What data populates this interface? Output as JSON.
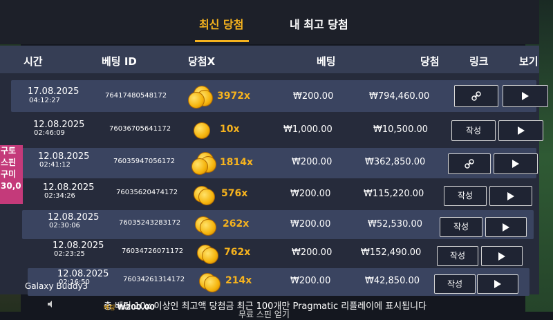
{
  "tabs": {
    "latest": "최신 당첨",
    "best": "내 최고 당첨"
  },
  "headers": {
    "time": "시간",
    "bet_id": "베팅 ID",
    "win_x": "당첨X",
    "bet": "베팅",
    "win": "당첨",
    "link": "링크",
    "view": "보기"
  },
  "rows": [
    {
      "date": "17.08.2025",
      "time": "04:12:27",
      "bet_id": "76417480548172",
      "coins": "stack",
      "multiplier": "3972x",
      "bet": "₩200.00",
      "win": "₩794,460.00",
      "link": "icon"
    },
    {
      "date": "12.08.2025",
      "time": "02:46:09",
      "bet_id": "76036705641172",
      "coins": "single",
      "multiplier": "10x",
      "bet": "₩1,000.00",
      "win": "₩10,500.00",
      "link": "작성"
    },
    {
      "date": "12.08.2025",
      "time": "02:41:12",
      "bet_id": "76035947056172",
      "coins": "stack",
      "multiplier": "1814x",
      "bet": "₩200.00",
      "win": "₩362,850.00",
      "link": "icon"
    },
    {
      "date": "12.08.2025",
      "time": "02:34:26",
      "bet_id": "76035620474172",
      "coins": "pair",
      "multiplier": "576x",
      "bet": "₩200.00",
      "win": "₩115,220.00",
      "link": "작성"
    },
    {
      "date": "12.08.2025",
      "time": "02:30:06",
      "bet_id": "76035243283172",
      "coins": "pair",
      "multiplier": "262x",
      "bet": "₩200.00",
      "win": "₩52,530.00",
      "link": "작성"
    },
    {
      "date": "12.08.2025",
      "time": "02:23:25",
      "bet_id": "76034726071172",
      "coins": "pair",
      "multiplier": "762x",
      "bet": "₩200.00",
      "win": "₩152,490.00",
      "link": "작성"
    },
    {
      "date": "12.08.2025",
      "time": "02:16:50",
      "bet_id": "76034261314172",
      "coins": "pair",
      "multiplier": "214x",
      "bet": "₩200.00",
      "win": "₩42,850.00",
      "link": "작성"
    }
  ],
  "footer": {
    "note": "총 베팅 10x 이상인 최고액 당첨금 최근 100개만 Pragmatic 리플레이에 표시됩니다",
    "next": "무료 스핀 얻기"
  },
  "watermark": "Galaxy Buddy3",
  "bottom_left": {
    "label": "베팅",
    "value": "₩200.00"
  },
  "promo_text": [
    "구토",
    "스핀",
    "구미",
    "30,0"
  ],
  "colors": {
    "accent": "#f6b31e",
    "header_bg": "#363e55",
    "row_alt": "#3a4460"
  }
}
